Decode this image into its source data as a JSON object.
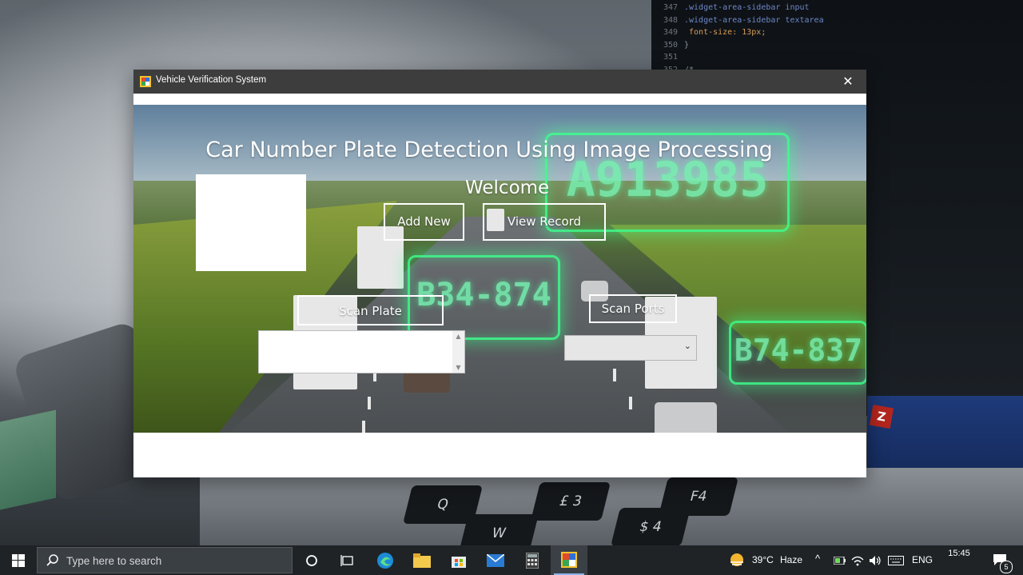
{
  "window": {
    "title": "Vehicle Verification System",
    "close_glyph": "✕"
  },
  "form": {
    "heading": "Car Number Plate Detection Using Image Processing",
    "welcome": "Welcome",
    "add_new_label": "Add New",
    "view_record_label": "View Record",
    "scan_plate_label": "Scan Plate",
    "scan_ports_label": "Scan Ports",
    "port_select_value": "",
    "plate_list_items": []
  },
  "background_plates": [
    "A913985",
    "B74-837",
    "B34-874"
  ],
  "taskbar": {
    "search_placeholder": "Type here to search",
    "weather_temp": "39°C",
    "weather_desc": "Haze",
    "language": "ENG",
    "time": "15:45",
    "notification_count": "5"
  },
  "wallpaper_code": [
    {
      "line": "347",
      "text": ".widget-area-sidebar input"
    },
    {
      "line": "348",
      "text": ".widget-area-sidebar textarea"
    },
    {
      "line": "349",
      "text": "    font-size: 13px;"
    },
    {
      "line": "350",
      "text": "}"
    },
    {
      "line": "351",
      "text": ""
    },
    {
      "line": "352",
      "text": "/* ..."
    }
  ],
  "keys": [
    "Q",
    "W",
    "£ 3",
    "$ 4",
    "F4"
  ]
}
